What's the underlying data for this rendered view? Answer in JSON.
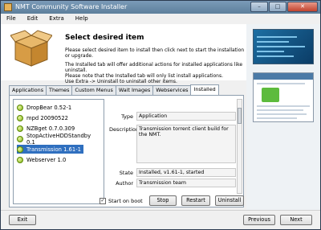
{
  "window": {
    "title": "NMT Community Software Installer"
  },
  "menu": [
    "File",
    "Edit",
    "Extra",
    "Help"
  ],
  "header": {
    "title": "Select desired item",
    "line1": "Please select desired item to install then click next to start the installation or upgrade.",
    "line2": "The Installed tab will offer additional actions for installed applications like uninstall.",
    "line3": "Please note that the Installed tab will only list install applications.",
    "line4": "Use Extra -> Uninstall to uninstall other items."
  },
  "tabs": [
    "Applications",
    "Themes",
    "Custom Menus",
    "Wait Images",
    "Webservices",
    "Installed"
  ],
  "items": [
    {
      "label": "DropBear 0.52-1"
    },
    {
      "label": "mpd 20090522"
    },
    {
      "label": "NZBget 0.7.0.309"
    },
    {
      "label": "StopActiveHDDStandby 0.1"
    },
    {
      "label": "Transmission 1.61-1"
    },
    {
      "label": "Webserver 1.0"
    }
  ],
  "details": {
    "type_label": "Type",
    "type_value": "Application",
    "desc_label": "Description",
    "desc_value": "Transmission torrent client build for the NMT.",
    "state_label": "State",
    "state_value": "Installed, v1.61-1, started",
    "author_label": "Author",
    "author_value": "Transmission team"
  },
  "controls": {
    "start_on_boot": "Start on boot",
    "stop": "Stop",
    "restart": "Restart",
    "uninstall": "Uninstall"
  },
  "footer": {
    "exit": "Exit",
    "previous": "Previous",
    "next": "Next"
  }
}
